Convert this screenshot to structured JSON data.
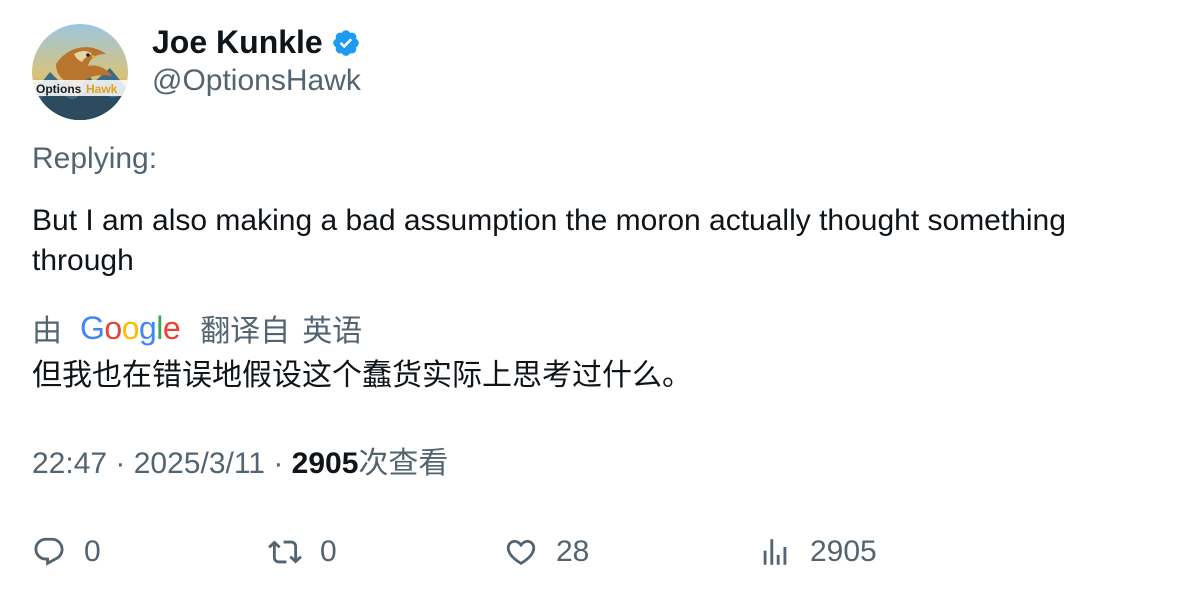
{
  "author": {
    "display_name": "Joe Kunkle",
    "handle": "@OptionsHawk",
    "verified": true,
    "avatar_text": "OptionsHawk"
  },
  "replying_label": "Replying:",
  "tweet_text": "But I am also making a bad assumption the moron actually thought something through",
  "translation": {
    "by_label": "由",
    "provider": "Google",
    "translated_from_label": "翻译自",
    "source_language": "英语",
    "translated_text": "但我也在错误地假设这个蠢货实际上思考过什么。"
  },
  "meta": {
    "time": "22:47",
    "separator": "·",
    "date": "2025/3/11",
    "views_count": "2905",
    "views_label": "次查看"
  },
  "actions": {
    "reply_count": "0",
    "retweet_count": "0",
    "like_count": "28",
    "views_count": "2905"
  },
  "colors": {
    "text_primary": "#0f1419",
    "text_secondary": "#536471",
    "verified_blue": "#1d9bf0"
  },
  "icons": {
    "reply": "reply-icon",
    "retweet": "retweet-icon",
    "like": "heart-icon",
    "views": "bar-chart-icon",
    "verified": "verified-badge-icon"
  }
}
